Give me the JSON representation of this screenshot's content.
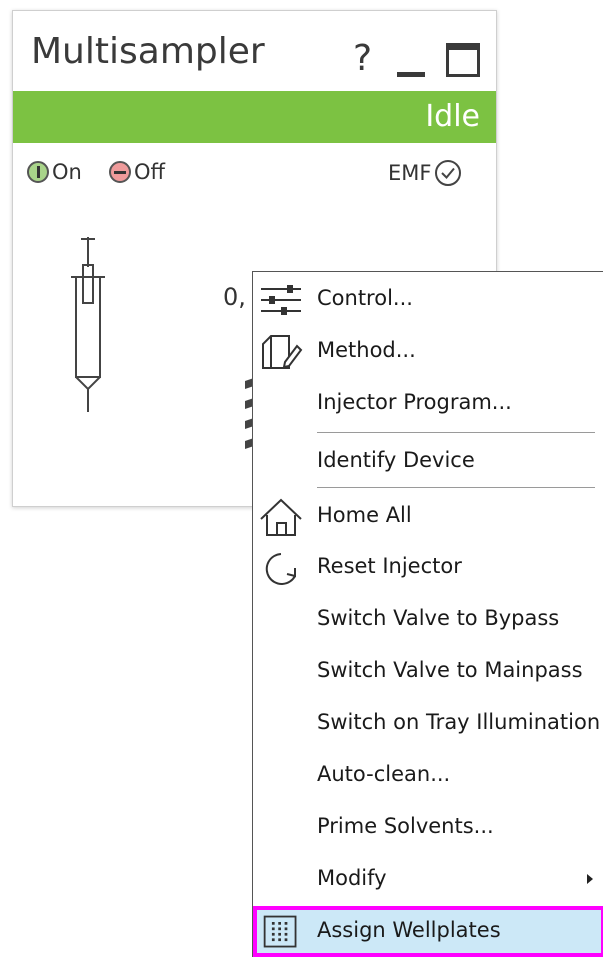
{
  "panel": {
    "title": "Multisampler",
    "help_label": "?",
    "status": "Idle",
    "status_color": "#7cc242",
    "on_label": "On",
    "off_label": "Off",
    "emf_label": "EMF",
    "value_text": "0,"
  },
  "menu": {
    "items": [
      {
        "label": "Control...",
        "icon": "sliders-icon"
      },
      {
        "label": "Method...",
        "icon": "method-edit-icon"
      },
      {
        "label": "Injector Program...",
        "icon": ""
      },
      {
        "label": "Identify Device",
        "icon": ""
      },
      {
        "label": "Home All",
        "icon": "home-icon"
      },
      {
        "label": "Reset Injector",
        "icon": "reset-icon"
      },
      {
        "label": "Switch Valve to Bypass",
        "icon": ""
      },
      {
        "label": "Switch Valve to Mainpass",
        "icon": ""
      },
      {
        "label": "Switch on Tray Illumination",
        "icon": ""
      },
      {
        "label": "Auto-clean...",
        "icon": ""
      },
      {
        "label": "Prime Solvents...",
        "icon": ""
      },
      {
        "label": "Modify",
        "icon": "submenu-arrow-icon"
      },
      {
        "label": "Assign Wellplates",
        "icon": "wellplate-grid-icon"
      }
    ],
    "highlight_color": "#ff00ff"
  }
}
